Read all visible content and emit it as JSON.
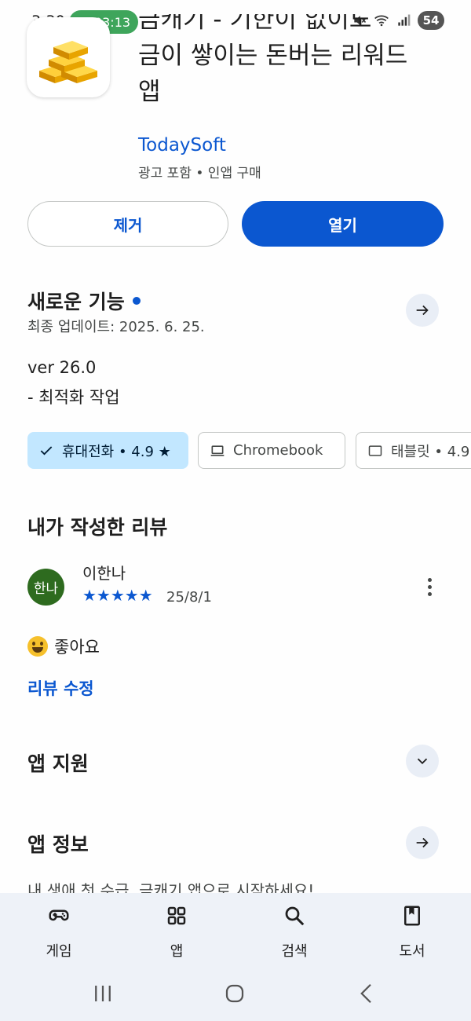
{
  "status_bar": {
    "time": "3:30",
    "call_timer": "03:13",
    "battery": "54",
    "icons": [
      "phone-icon",
      "mute-icon",
      "wifi-icon",
      "signal-icon"
    ]
  },
  "app": {
    "title_line1": "금캐기 - 기한이 없이도",
    "title_line2": "금이 쌓이는 돈버는 리워드",
    "title_line3": "앱",
    "developer": "TodaySoft",
    "ad_info": "광고 포함 • 인앱 구매",
    "icon": "gold-bars-icon"
  },
  "actions": {
    "uninstall_label": "제거",
    "open_label": "열기"
  },
  "whats_new": {
    "title": "새로운 기능",
    "last_updated": "최종 업데이트: 2025. 6. 25.",
    "version": "ver 26.0",
    "notes": "- 최적화 작업"
  },
  "device_chips": [
    {
      "label": "휴대전화 • 4.9 ★",
      "selected": true,
      "icon": "check-icon"
    },
    {
      "label": "Chromebook",
      "selected": false,
      "icon": "laptop-icon"
    },
    {
      "label": "태블릿 • 4.9",
      "selected": false,
      "icon": "tablet-icon"
    }
  ],
  "my_review": {
    "section_title": "내가 작성한 리뷰",
    "avatar_text": "한나",
    "reviewer_name": "이한나",
    "rating": 5,
    "stars": "★★★★★",
    "date": "25/8/1",
    "text": "좋아요",
    "edit_label": "리뷰 수정"
  },
  "app_support": {
    "title": "앱 지원"
  },
  "app_info": {
    "title": "앱 정보",
    "partial_text": "내 생애 첫 수급, 금캐기 앱으로 시작하세요!"
  },
  "bottom_nav": [
    {
      "label": "게임",
      "icon": "gamepad-icon"
    },
    {
      "label": "앱",
      "icon": "apps-grid-icon"
    },
    {
      "label": "검색",
      "icon": "search-icon"
    },
    {
      "label": "도서",
      "icon": "book-icon"
    }
  ],
  "colors": {
    "accent": "#0b57d0",
    "chip_selected": "#c2e7ff",
    "nav_background": "#eef2f8",
    "avatar": "#2e6b1f"
  }
}
